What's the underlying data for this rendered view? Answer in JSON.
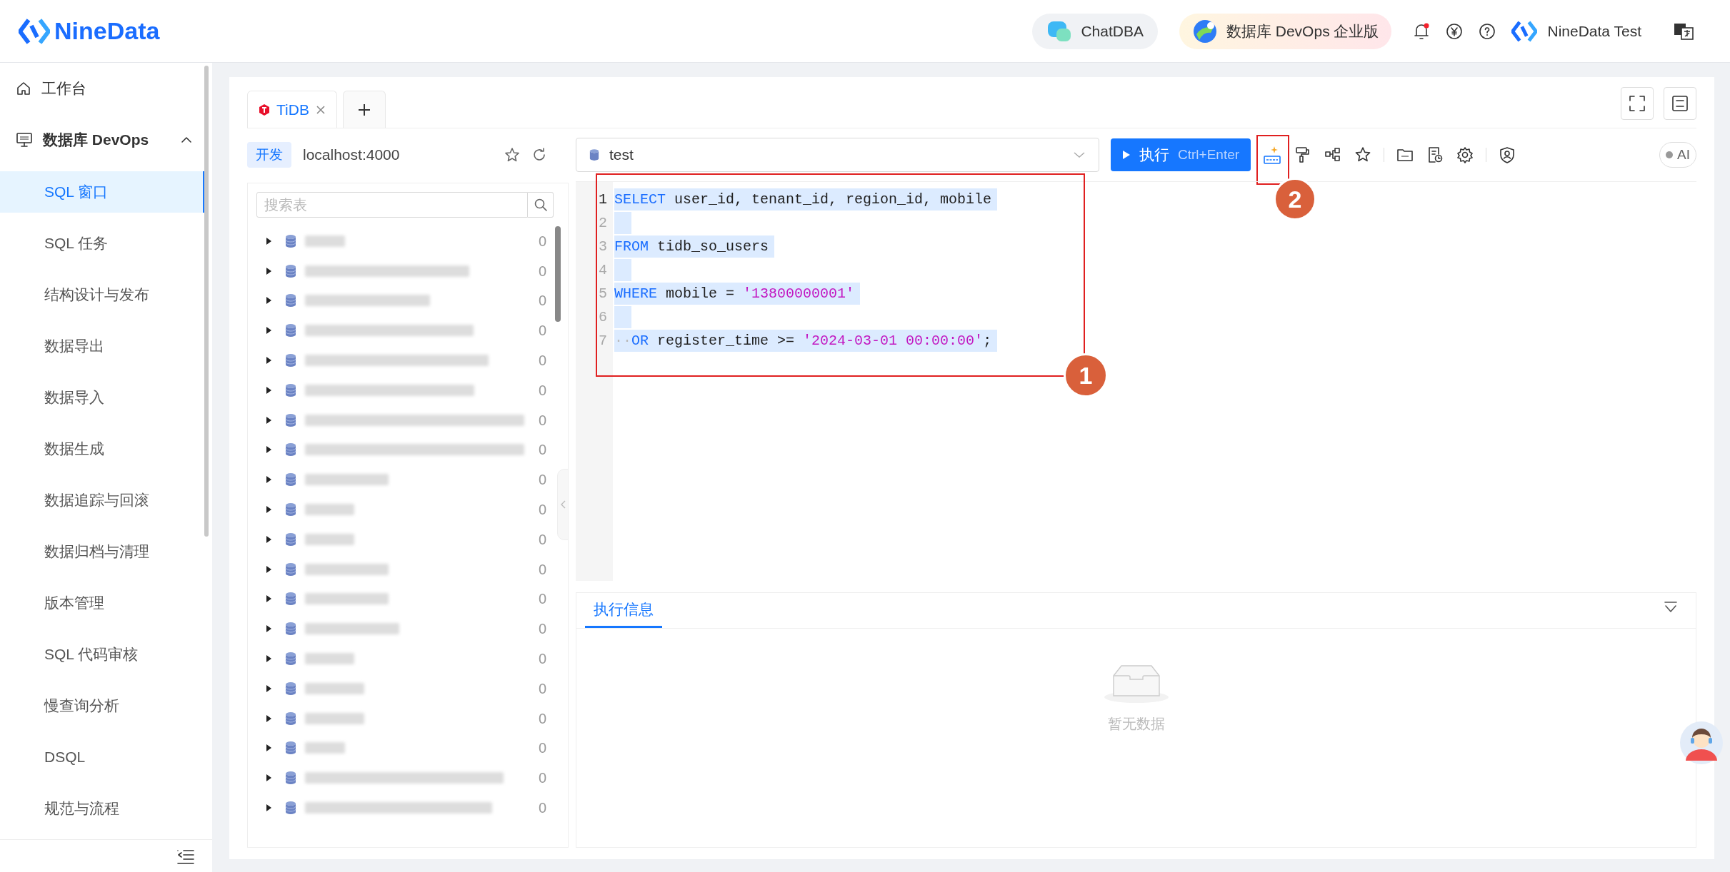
{
  "header": {
    "logo": "NineData",
    "chat_button": "ChatDBA",
    "edition_button": "数据库 DevOps 企业版",
    "user": "NineData Test"
  },
  "sidebar": {
    "items": [
      {
        "label": "工作台",
        "kind": "link",
        "selected": false
      },
      {
        "label": "数据库 DevOps",
        "kind": "group",
        "expanded": true,
        "children": [
          {
            "label": "SQL 窗口",
            "selected": true
          },
          {
            "label": "SQL 任务",
            "selected": false
          },
          {
            "label": "结构设计与发布",
            "selected": false
          },
          {
            "label": "数据导出",
            "selected": false
          },
          {
            "label": "数据导入",
            "selected": false
          },
          {
            "label": "数据生成",
            "selected": false
          },
          {
            "label": "数据追踪与回滚",
            "selected": false
          },
          {
            "label": "数据归档与清理",
            "selected": false
          },
          {
            "label": "版本管理",
            "selected": false
          },
          {
            "label": "SQL 代码审核",
            "selected": false
          },
          {
            "label": "慢查询分析",
            "selected": false
          },
          {
            "label": "DSQL",
            "selected": false
          },
          {
            "label": "规范与流程",
            "selected": false
          }
        ]
      }
    ]
  },
  "tabs": [
    {
      "label": "TiDB",
      "selected": true
    }
  ],
  "connection": {
    "env": "开发",
    "host": "localhost:4000"
  },
  "table_search": {
    "placeholder": "搜索表"
  },
  "tables": [
    {
      "count": "0"
    },
    {
      "count": "0"
    },
    {
      "count": "0"
    },
    {
      "count": "0"
    },
    {
      "count": "0"
    },
    {
      "count": "0"
    },
    {
      "count": "0"
    },
    {
      "count": "0"
    },
    {
      "count": "0"
    },
    {
      "count": "0"
    },
    {
      "count": "0"
    },
    {
      "count": "0"
    },
    {
      "count": "0"
    },
    {
      "count": "0"
    },
    {
      "count": "0"
    },
    {
      "count": "0"
    },
    {
      "count": "0"
    },
    {
      "count": "0"
    },
    {
      "count": "0"
    },
    {
      "count": "0"
    }
  ],
  "database_select": {
    "value": "test"
  },
  "run_button": {
    "label": "执行",
    "shortcut": "Ctrl+Enter"
  },
  "ai_toggle": {
    "label": "AI",
    "on": false
  },
  "editor": {
    "lines": [
      {
        "number": "1",
        "current": true,
        "tokens": [
          {
            "kind": "keyword",
            "text": "SELECT"
          },
          {
            "kind": "plain",
            "text": " user_id, tenant_id, region_id, mobile"
          }
        ]
      },
      {
        "number": "2",
        "current": false
      },
      {
        "number": "3",
        "current": false,
        "tokens": [
          {
            "kind": "keyword",
            "text": "FROM"
          },
          {
            "kind": "plain",
            "text": " tidb_so_users"
          }
        ]
      },
      {
        "number": "4",
        "current": false
      },
      {
        "number": "5",
        "current": false,
        "tokens": [
          {
            "kind": "keyword",
            "text": "WHERE"
          },
          {
            "kind": "plain",
            "text": " mobile = "
          },
          {
            "kind": "string",
            "text": "'13800000001'"
          }
        ]
      },
      {
        "number": "6",
        "current": false
      },
      {
        "number": "7",
        "current": false,
        "tokens": [
          {
            "kind": "whitespace",
            "text": "··"
          },
          {
            "kind": "keyword",
            "text": "OR"
          },
          {
            "kind": "plain",
            "text": " register_time >= "
          },
          {
            "kind": "string",
            "text": "'2024-03-01 00:00:00'"
          },
          {
            "kind": "plain",
            "text": ";"
          }
        ]
      }
    ]
  },
  "result_panel": {
    "tabs": [
      {
        "label": "执行信息",
        "selected": true
      }
    ],
    "empty_text": "暂无数据"
  },
  "annotations": [
    {
      "label": "1"
    },
    {
      "label": "2"
    }
  ]
}
